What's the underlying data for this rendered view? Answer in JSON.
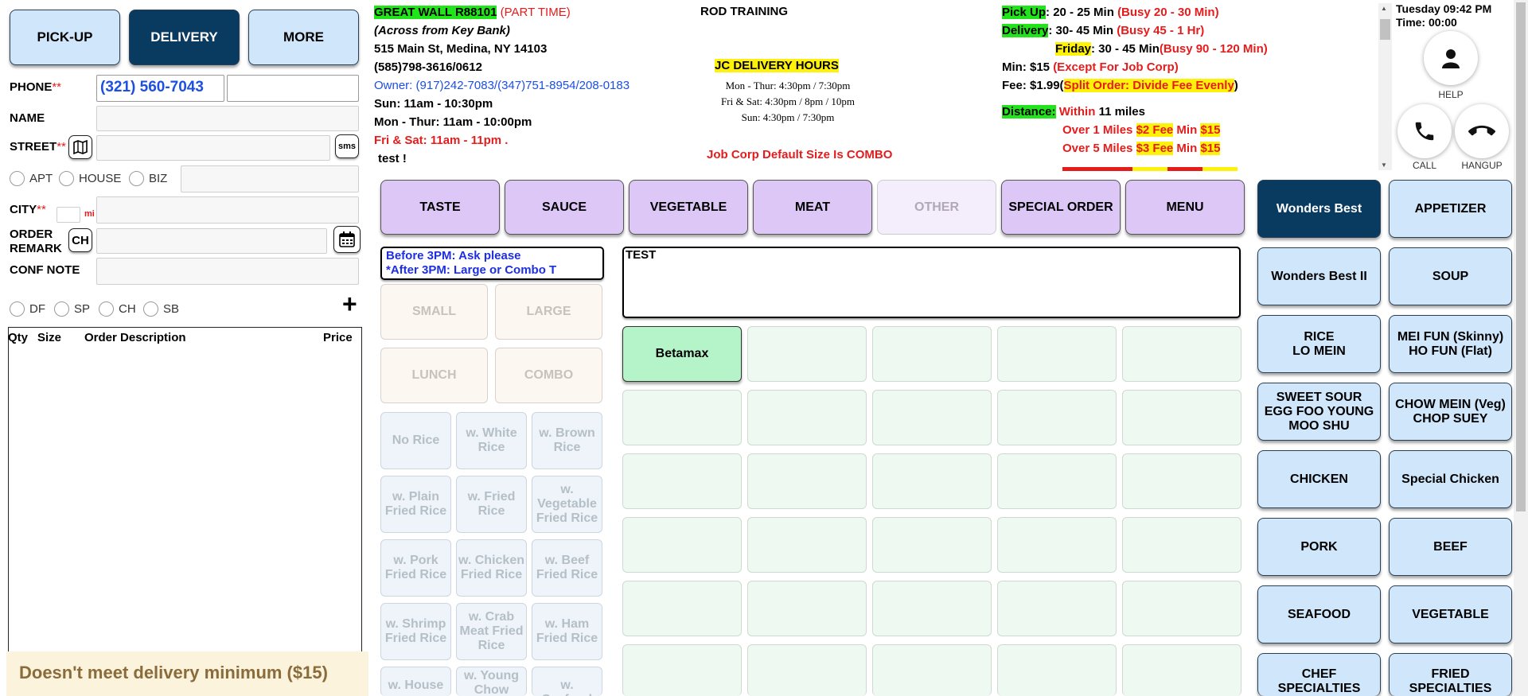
{
  "mode_buttons": {
    "pickup": "PICK-UP",
    "delivery": "DELIVERY",
    "more": "MORE"
  },
  "form": {
    "phone_label": "PHONE",
    "phone_value": "(321) 560-7043",
    "name_label": "NAME",
    "street_label": "STREET",
    "sms_label": "sms",
    "apt_label": "APT",
    "house_label": "HOUSE",
    "biz_label": "BIZ",
    "city_label": "CITY",
    "mi_label": "mi",
    "order_label": "ORDER",
    "remark_label": "REMARK",
    "ch_label": "CH",
    "conf_note_label": "CONF NOTE",
    "required_mark": "**",
    "radios2": [
      "DF",
      "SP",
      "CH",
      "SB"
    ],
    "plus": "+"
  },
  "order_table": {
    "qty": "Qty",
    "size": "Size",
    "desc": "Order Description",
    "price": "Price"
  },
  "min_warning": "Doesn't meet delivery minimum ($15)",
  "store": {
    "name": "GREAT WALL R88101",
    "part_time": "(PART TIME)",
    "across": "(Across from Key Bank)",
    "address": "515 Main St, Medina, NY 14103",
    "phone": "(585)798-3616/0612",
    "owner": "Owner: (917)242-7083/(347)751-8954/208-0183",
    "hours1": "Sun: 11am - 10:30pm",
    "hours2": "Mon - Thur: 11am - 10:00pm",
    "hours3": "Fri & Sat: 11am - 11pm .",
    "note": "test !"
  },
  "center_info": {
    "training": "ROD TRAINING",
    "jc_title": "JC DELIVERY HOURS",
    "jc1": "Mon - Thur: 4:30pm / 7:30pm",
    "jc2": "Fri & Sat: 4:30pm / 8pm / 10pm",
    "jc3": "Sun: 4:30pm / 7:30pm",
    "jobcorp": "Job Corp Default Size Is COMBO"
  },
  "right_info": {
    "pickup_label": "Pick Up",
    "pickup_time": ": 20 - 25 Min ",
    "pickup_busy": "(Busy 20 - 30 Min)",
    "delivery_label": "Delivery",
    "delivery_time": ": 30- 45 Min ",
    "delivery_busy": "(Busy 45 - 1 Hr)",
    "friday_label": "Friday",
    "friday_time": ": 30 - 45 Min",
    "friday_busy": "(Busy 90 - 120 Min)",
    "min_text": "Min: $15 ",
    "min_except": "(Except For Job Corp)",
    "fee_text": "Fee: $1.99(",
    "fee_split": "Split Order: Divide Fee Evenly",
    "fee_close": ")",
    "distance_label": "Distance:",
    "within": " Within ",
    "within_miles": "11 miles",
    "over1": "Over 1 Miles ",
    "over1_fee": "$2 Fee",
    "over1_min": " Min ",
    "over1_minval": "$15",
    "over5": "Over 5 Miles ",
    "over5_fee": "$3 Fee",
    "over5_min": " Min ",
    "over5_minval": "$15"
  },
  "clock": {
    "day": "Tuesday 09:42 PM",
    "time": "Time: 00:00"
  },
  "phone_controls": {
    "help": "HELP",
    "call": "CALL",
    "hangup": "HANGUP"
  },
  "categories": [
    "TASTE",
    "SAUCE",
    "VEGETABLE",
    "MEAT",
    "OTHER",
    "SPECIAL ORDER",
    "MENU"
  ],
  "size_note": {
    "line1": "Before 3PM:  Ask please",
    "line2": "*After 3PM:  Large or Combo T"
  },
  "item_note": "TEST",
  "sizes": [
    "SMALL",
    "LARGE",
    "LUNCH",
    "COMBO"
  ],
  "rice_options": [
    "No Rice",
    "w. White Rice",
    "w. Brown Rice",
    "w. Plain Fried Rice",
    "w. Fried Rice",
    "w. Vegetable Fried Rice",
    "w. Pork Fried Rice",
    "w. Chicken Fried Rice",
    "w. Beef Fried Rice",
    "w. Shrimp Fried Rice",
    "w. Crab Meat Fried Rice",
    "w. Ham Fried Rice",
    "w. House",
    "w. Young Chow Fried",
    "w. Seafood"
  ],
  "grid_item": "Betamax",
  "menu_categories": [
    "Wonders Best",
    "APPETIZER",
    "Wonders Best II",
    "SOUP",
    "RICE\nLO MEIN",
    "MEI FUN (Skinny)\nHO FUN (Flat)",
    "SWEET SOUR\nEGG FOO YOUNG\nMOO SHU",
    "CHOW MEIN (Veg)\nCHOP SUEY",
    "CHICKEN",
    "Special Chicken",
    "PORK",
    "BEEF",
    "SEAFOOD",
    "VEGETABLE",
    "CHEF\nSPECIALTIES",
    "FRIED\nSPECIALTIES"
  ],
  "colors": {
    "active": "#093a60",
    "button": "#cfe6fb",
    "category": "#dcc7f7",
    "grid": "#eefaf1",
    "warning_bg": "#fbf3dc",
    "warning_fg": "#8a6b3a"
  }
}
